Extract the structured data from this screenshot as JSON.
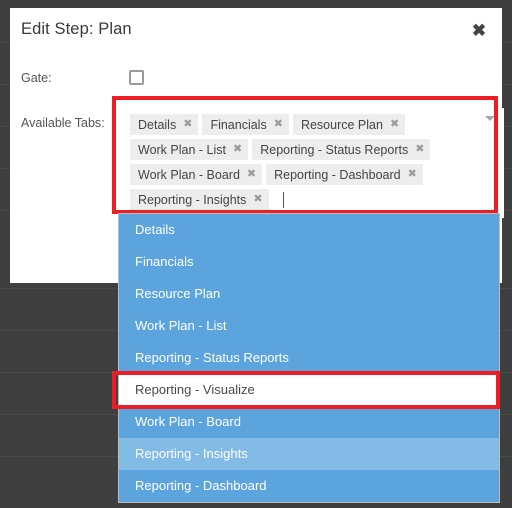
{
  "modal": {
    "title": "Edit Step: Plan",
    "close_label": "✖",
    "close_icon": "close-icon"
  },
  "form": {
    "gate": {
      "label": "Gate:",
      "checked": false
    },
    "available_tabs": {
      "label": "Available Tabs:",
      "placeholder": "",
      "input_value": "",
      "caret_icon": "chevron-down-icon",
      "tags": [
        {
          "label": "Details",
          "remove_icon": "✖"
        },
        {
          "label": "Financials",
          "remove_icon": "✖"
        },
        {
          "label": "Resource Plan",
          "remove_icon": "✖"
        },
        {
          "label": "Work Plan - List",
          "remove_icon": "✖"
        },
        {
          "label": "Reporting - Status Reports",
          "remove_icon": "✖"
        },
        {
          "label": "Work Plan - Board",
          "remove_icon": "✖"
        },
        {
          "label": "Reporting - Dashboard",
          "remove_icon": "✖"
        },
        {
          "label": "Reporting - Insights",
          "remove_icon": "✖"
        }
      ]
    }
  },
  "dropdown": {
    "items": [
      {
        "label": "Details",
        "state": "selected"
      },
      {
        "label": "Financials",
        "state": "selected"
      },
      {
        "label": "Resource Plan",
        "state": "selected"
      },
      {
        "label": "Work Plan - List",
        "state": "selected"
      },
      {
        "label": "Reporting - Status Reports",
        "state": "selected"
      },
      {
        "label": "Reporting - Visualize",
        "state": "unselected"
      },
      {
        "label": "Work Plan - Board",
        "state": "selected"
      },
      {
        "label": "Reporting - Insights",
        "state": "hovered"
      },
      {
        "label": "Reporting - Dashboard",
        "state": "selected"
      }
    ]
  },
  "buttons": {
    "primary_label": ""
  },
  "colors": {
    "accent_blue": "#5ba4dd",
    "accent_blue_hover": "#82bbe6",
    "primary_button": "#2e80bd",
    "highlight_red": "#ee1c25",
    "page_background": "#3f3f3f",
    "tag_background": "#ededed"
  }
}
